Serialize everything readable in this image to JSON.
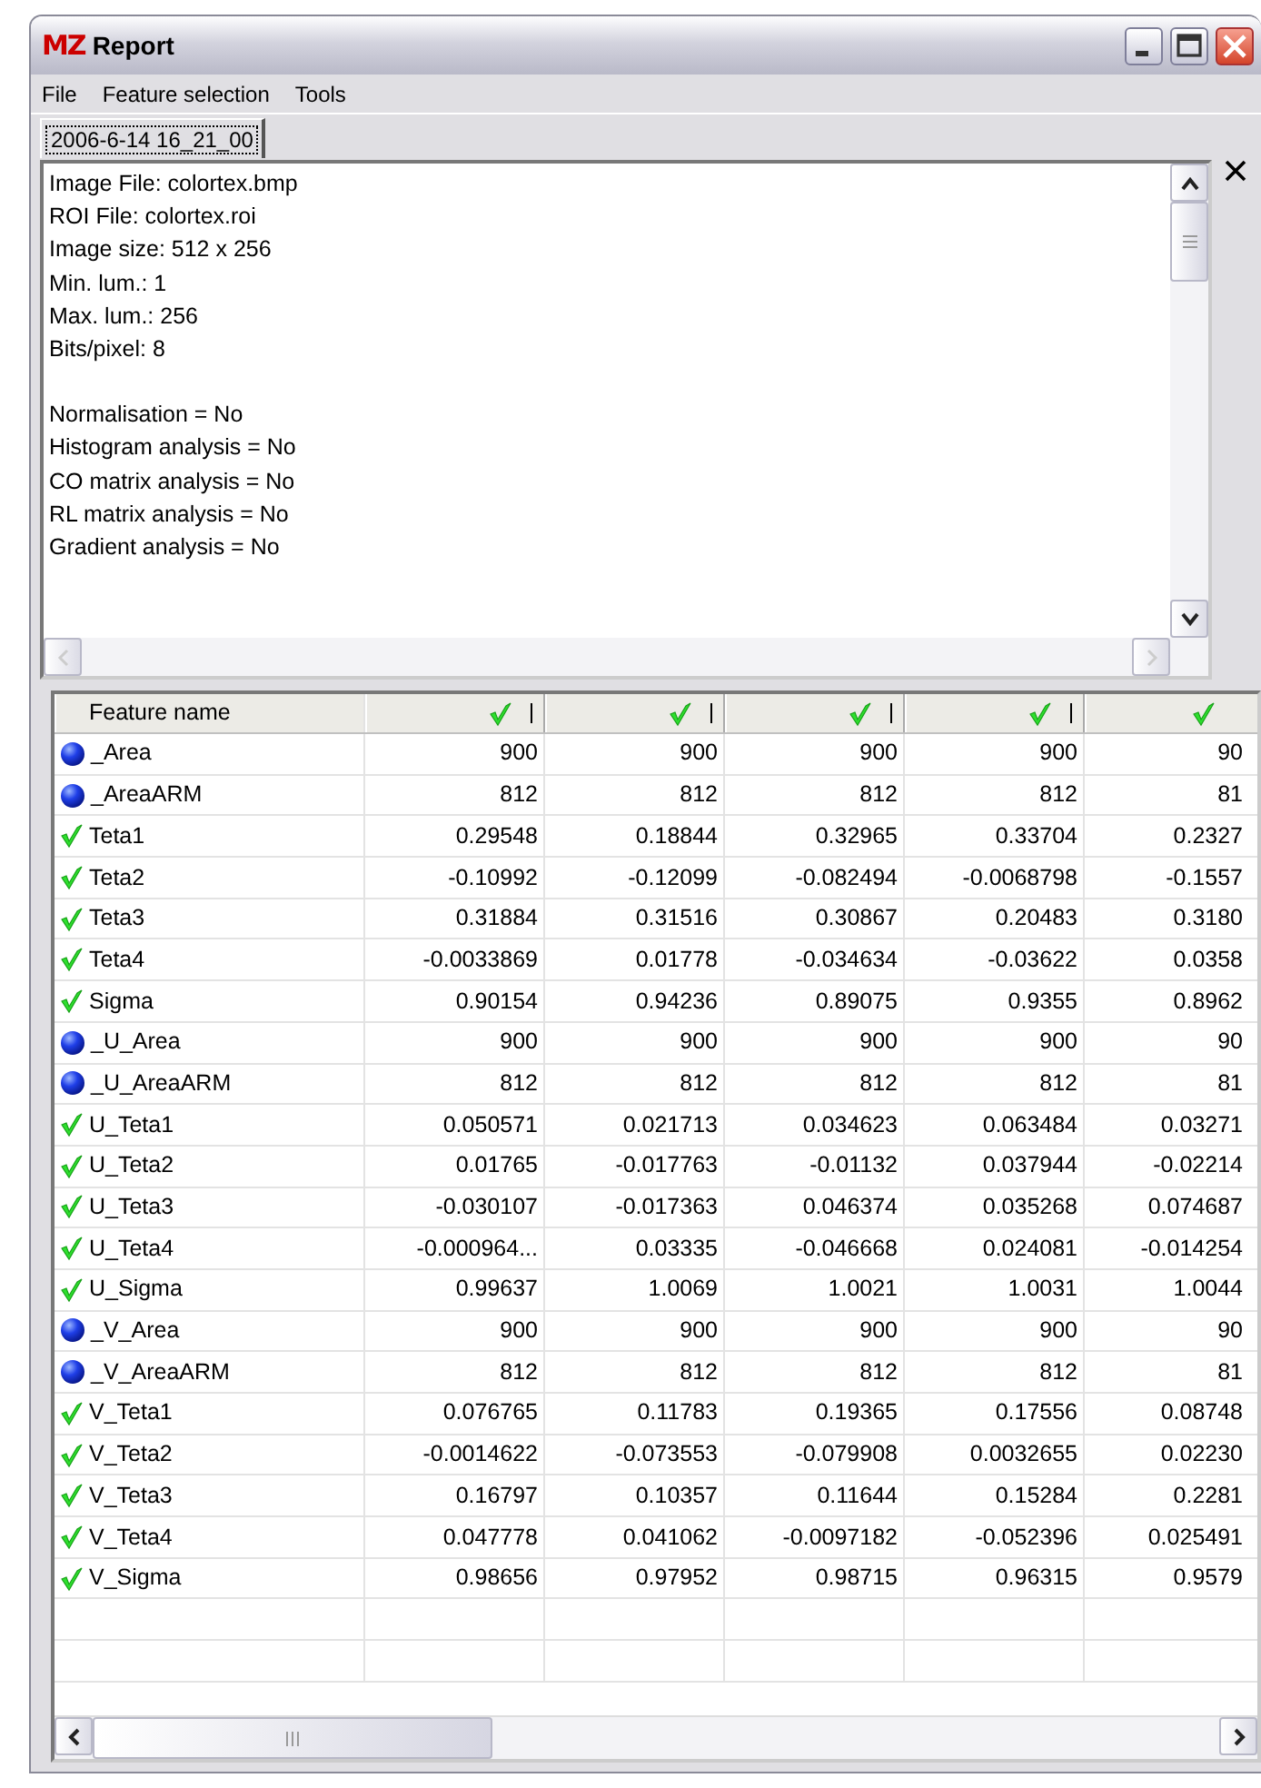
{
  "window": {
    "logo": "MZ",
    "title": "Report"
  },
  "menu": [
    "File",
    "Feature selection",
    "Tools"
  ],
  "tabs": [
    {
      "label": "2006-6-14 16_21_00",
      "selected": true
    }
  ],
  "report_sections": [
    [
      "Image File: colortex.bmp",
      "ROI File: colortex.roi",
      "Image size: 512 x 256",
      "Min. lum.: 1",
      "Max. lum.: 256",
      "Bits/pixel: 8"
    ],
    [
      "Normalisation =  No",
      "Histogram analysis = No",
      "CO matrix analysis = No",
      "RL matrix analysis = No",
      "Gradient analysis = No"
    ]
  ],
  "table": {
    "first_column": "Feature name",
    "columns": [
      {
        "checked": true
      },
      {
        "checked": true
      },
      {
        "checked": true
      },
      {
        "checked": true
      },
      {
        "checked": true
      }
    ],
    "rows": [
      {
        "kind": "dot",
        "name": "_Area",
        "values": [
          "900",
          "900",
          "900",
          "900",
          "90"
        ]
      },
      {
        "kind": "dot",
        "name": "_AreaARM",
        "values": [
          "812",
          "812",
          "812",
          "812",
          "81"
        ]
      },
      {
        "kind": "check",
        "name": "Teta1",
        "values": [
          "0.29548",
          "0.18844",
          "0.32965",
          "0.33704",
          "0.2327"
        ]
      },
      {
        "kind": "check",
        "name": "Teta2",
        "values": [
          "-0.10992",
          "-0.12099",
          "-0.082494",
          "-0.0068798",
          "-0.1557"
        ]
      },
      {
        "kind": "check",
        "name": "Teta3",
        "values": [
          "0.31884",
          "0.31516",
          "0.30867",
          "0.20483",
          "0.3180"
        ]
      },
      {
        "kind": "check",
        "name": "Teta4",
        "values": [
          "-0.0033869",
          "0.01778",
          "-0.034634",
          "-0.03622",
          "0.0358"
        ]
      },
      {
        "kind": "check",
        "name": "Sigma",
        "values": [
          "0.90154",
          "0.94236",
          "0.89075",
          "0.9355",
          "0.8962"
        ]
      },
      {
        "kind": "dot",
        "name": "_U_Area",
        "values": [
          "900",
          "900",
          "900",
          "900",
          "90"
        ]
      },
      {
        "kind": "dot",
        "name": "_U_AreaARM",
        "values": [
          "812",
          "812",
          "812",
          "812",
          "81"
        ]
      },
      {
        "kind": "check",
        "name": "U_Teta1",
        "values": [
          "0.050571",
          "0.021713",
          "0.034623",
          "0.063484",
          "0.03271"
        ]
      },
      {
        "kind": "check",
        "name": "U_Teta2",
        "values": [
          "0.01765",
          "-0.017763",
          "-0.01132",
          "0.037944",
          "-0.02214"
        ]
      },
      {
        "kind": "check",
        "name": "U_Teta3",
        "values": [
          "-0.030107",
          "-0.017363",
          "0.046374",
          "0.035268",
          "0.074687"
        ]
      },
      {
        "kind": "check",
        "name": "U_Teta4",
        "values": [
          "-0.000964...",
          "0.03335",
          "-0.046668",
          "0.024081",
          "-0.014254"
        ]
      },
      {
        "kind": "check",
        "name": "U_Sigma",
        "values": [
          "0.99637",
          "1.0069",
          "1.0021",
          "1.0031",
          "1.0044"
        ]
      },
      {
        "kind": "dot",
        "name": "_V_Area",
        "values": [
          "900",
          "900",
          "900",
          "900",
          "90"
        ]
      },
      {
        "kind": "dot",
        "name": "_V_AreaARM",
        "values": [
          "812",
          "812",
          "812",
          "812",
          "81"
        ]
      },
      {
        "kind": "check",
        "name": "V_Teta1",
        "values": [
          "0.076765",
          "0.11783",
          "0.19365",
          "0.17556",
          "0.08748"
        ]
      },
      {
        "kind": "check",
        "name": "V_Teta2",
        "values": [
          "-0.0014622",
          "-0.073553",
          "-0.079908",
          "0.0032655",
          "0.02230"
        ]
      },
      {
        "kind": "check",
        "name": "V_Teta3",
        "values": [
          "0.16797",
          "0.10357",
          "0.11644",
          "0.15284",
          "0.2281"
        ]
      },
      {
        "kind": "check",
        "name": "V_Teta4",
        "values": [
          "0.047778",
          "0.041062",
          "-0.0097182",
          "-0.052396",
          "0.025491"
        ]
      },
      {
        "kind": "check",
        "name": "V_Sigma",
        "values": [
          "0.98656",
          "0.97952",
          "0.98715",
          "0.96315",
          "0.9579"
        ]
      }
    ]
  }
}
